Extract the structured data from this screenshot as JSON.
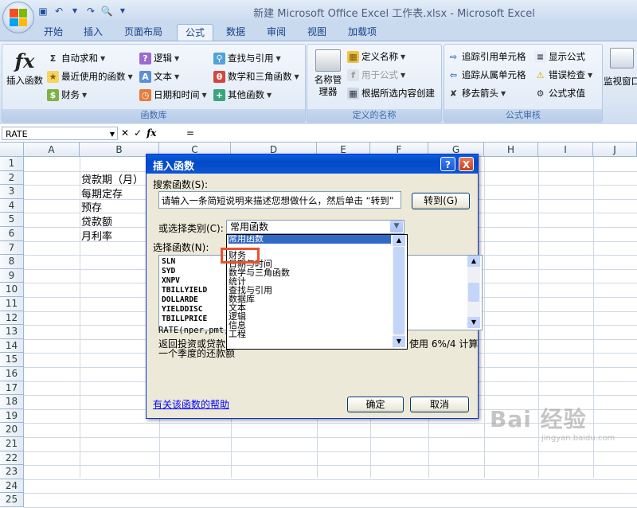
{
  "window": {
    "title": "新建 Microsoft Office Excel 工作表.xlsx - Microsoft Excel"
  },
  "tabs": [
    "开始",
    "插入",
    "页面布局",
    "公式",
    "数据",
    "审阅",
    "视图",
    "加载项"
  ],
  "active_tab": "公式",
  "ribbon": {
    "function_library": {
      "label": "函数库",
      "insert_function": "插入函数",
      "autosum": "自动求和",
      "recent": "最近使用的函数",
      "financial": "财务",
      "logical": "逻辑",
      "text": "文本",
      "datetime": "日期和时间",
      "lookup": "查找与引用",
      "math": "数学和三角函数",
      "other": "其他函数"
    },
    "defined_names": {
      "label": "定义的名称",
      "name_manager": "名称管理器",
      "define_name": "定义名称",
      "use_in_formula": "用于公式",
      "create_from_selection": "根据所选内容创建"
    },
    "formula_auditing": {
      "label": "公式审核",
      "trace_precedents": "追踪引用单元格",
      "trace_dependents": "追踪从属单元格",
      "remove_arrows": "移去箭头",
      "show_formulas": "显示公式",
      "error_checking": "错误检查",
      "evaluate_formula": "公式求值"
    },
    "watch_window": "监视窗口"
  },
  "formula_bar": {
    "name_box": "RATE",
    "formula": "="
  },
  "columns": [
    "A",
    "B",
    "C",
    "D",
    "E",
    "F",
    "G",
    "H",
    "I",
    "J"
  ],
  "rows": [
    "1",
    "2",
    "3",
    "4",
    "5",
    "6",
    "7",
    "8",
    "9",
    "10",
    "11",
    "12",
    "13",
    "14",
    "15",
    "16",
    "17",
    "18",
    "19",
    "20",
    "21",
    "22",
    "23",
    "24",
    "25"
  ],
  "cells": {
    "B3": "贷款期（月）",
    "B4": "每期定存",
    "B5": "预存",
    "B6": "贷款额",
    "B7": "月利率"
  },
  "dialog": {
    "title": "插入函数",
    "search_label": "搜索函数(S):",
    "search_text": "请输入一条简短说明来描述您想做什么，然后单击 “转到”",
    "go_button": "转到(G)",
    "category_label": "或选择类别(C):",
    "category_value": "常用函数",
    "category_options": [
      "常用函数",
      "财务",
      "日期与时间",
      "数学与三角函数",
      "统计",
      "查找与引用",
      "数据库",
      "文本",
      "逻辑",
      "信息",
      "工程"
    ],
    "category_highlighted": "常用函数",
    "select_label": "选择函数(N):",
    "functions": [
      "SLN",
      "SYD",
      "XNPV",
      "TBILLYIELD",
      "DOLLARDE",
      "YIELDDISC",
      "TBILLPRICE"
    ],
    "syntax": "RATE(nper,pmt,p",
    "description_line1": "返回投资或贷款",
    "description_line1_end": "使用 6%/4 计算",
    "description_line2": "一个季度的还款额",
    "help_link": "有关该函数的帮助",
    "ok_button": "确定",
    "cancel_button": "取消",
    "help_btn": "?",
    "close_btn": "X"
  },
  "annotation": {
    "highlight_target": "财务",
    "color": "#e8532e"
  },
  "watermark": {
    "main": "Bai 经验",
    "sub": "jingyan.baidu.com"
  },
  "colors": {
    "accent": "#15428b",
    "dialog_title": "#0a5fde",
    "selection": "#316ac5"
  }
}
